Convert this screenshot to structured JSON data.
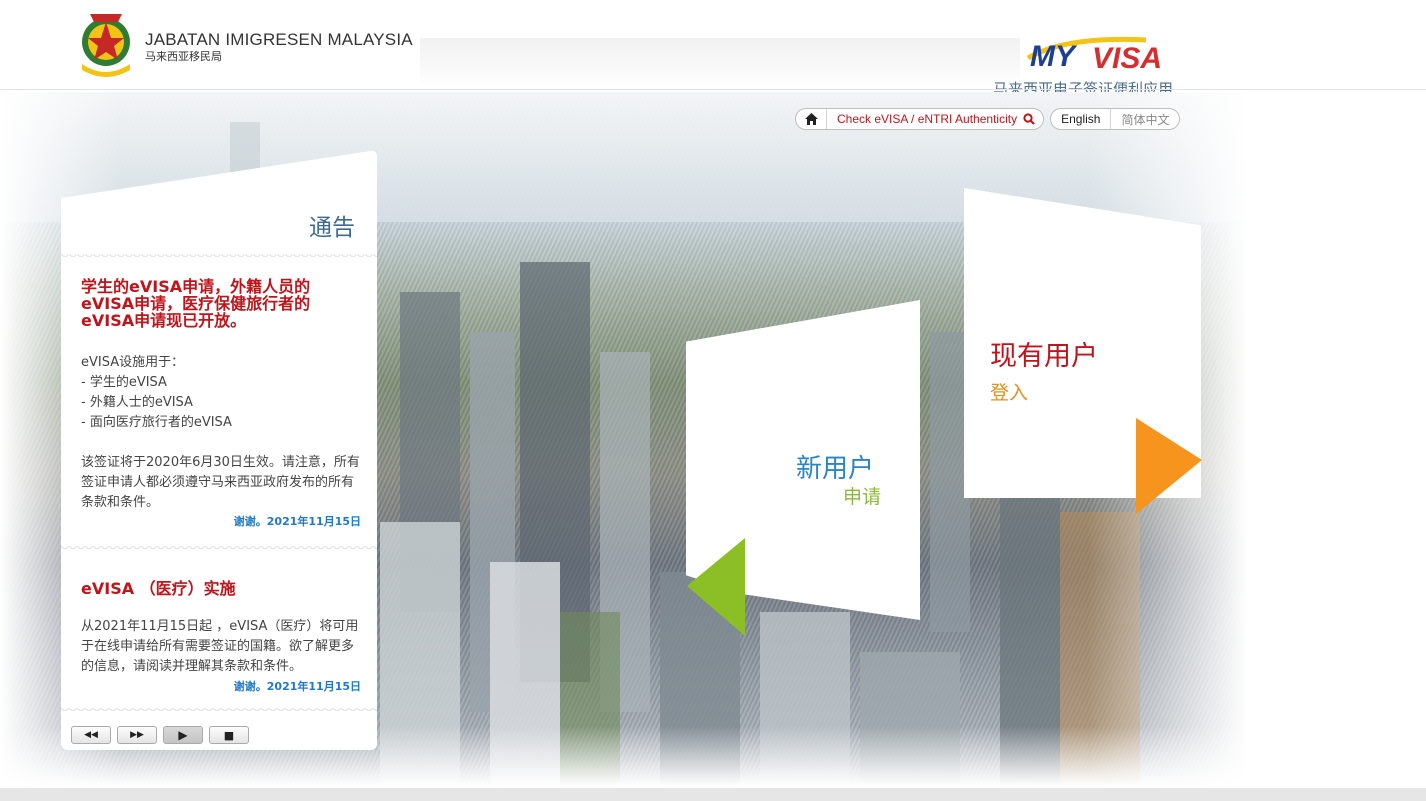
{
  "header": {
    "agency_en": "JABATAN IMIGRESEN MALAYSIA",
    "agency_zh": "马来西亚移民局",
    "crest_text": "IMIGRESEN MALAYSIA",
    "logo_text": "MYVISA",
    "app_title": "马来西亚电子签证便利应用"
  },
  "nav": {
    "home_icon": "home-icon",
    "check_label": "Check eVISA / eNTRI Authenticity",
    "search_icon": "search-icon",
    "lang_en": "English",
    "lang_zh": "简体中文"
  },
  "notice": {
    "title": "通告",
    "items": [
      {
        "heading": "学生的eVISA申请，外籍人员的eVISA申请，医疗保健旅行者的eVISA申请现已开放。",
        "body_lines": [
          "eVISA设施用于：",
          "- 学生的eVISA",
          "- 外籍人士的eVISA",
          "- 面向医疗旅行者的eVISA"
        ],
        "body2": "该签证将于2020年6月30日生效。请注意，所有签证申请人都必须遵守马来西亚政府发布的所有条款和条件。",
        "date": "谢谢。2021年11月15日"
      },
      {
        "heading": "eVISA （医疗）实施",
        "body": "从2021年11月15日起 ，eVISA（医疗）将可用于在线申请给所有需要签证的国籍。欲了解更多的信息，请阅读并理解其条款和条件。",
        "date": "谢谢。2021年11月15日"
      }
    ],
    "controls": [
      "rewind-icon",
      "forward-icon",
      "play-icon",
      "stop-icon"
    ]
  },
  "new_user": {
    "title": "新用户",
    "subtitle": "申请",
    "arrow_color": "#8cbf26"
  },
  "existing_user": {
    "title": "现有用户",
    "subtitle": "登入",
    "arrow_color": "#f7941d"
  },
  "colors": {
    "brand_red": "#c0141b",
    "brand_blue": "#2a84c9",
    "green": "#8cbf26",
    "orange": "#f7941d"
  }
}
